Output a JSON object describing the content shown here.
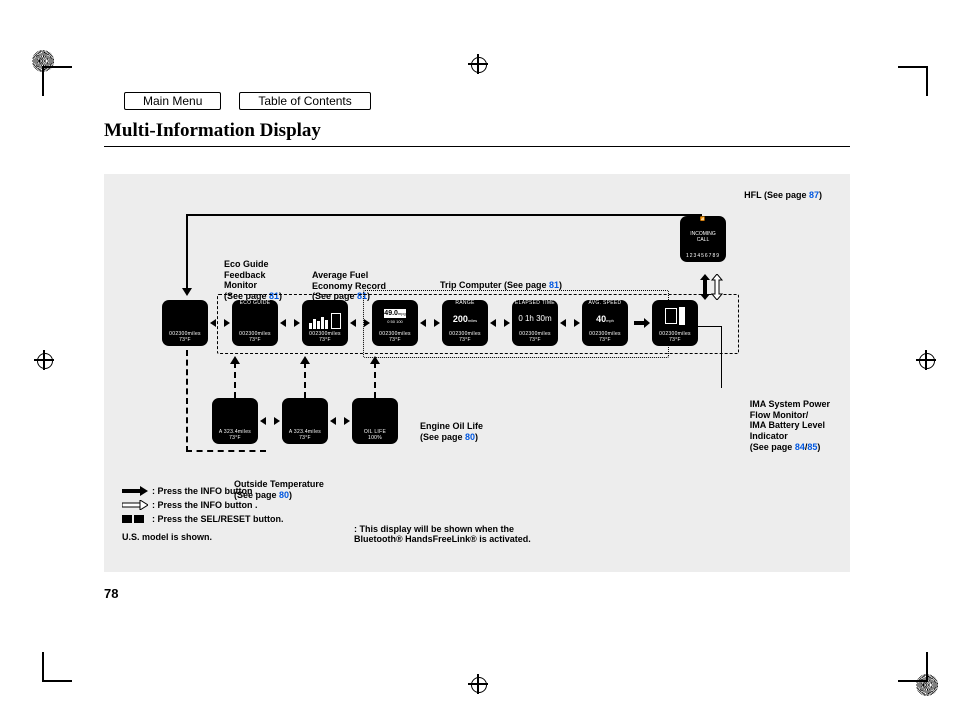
{
  "nav": {
    "main_menu": "Main Menu",
    "toc": "Table of Contents"
  },
  "title": "Multi-Information Display",
  "page_number": "78",
  "labels": {
    "hfl": "HFL   (See page ",
    "hfl_pg": "87",
    "hfl_end": ")",
    "eco": "Eco Guide\nFeedback\nMonitor\n(See page ",
    "eco_pg": "81",
    "eco_end": ")",
    "avg": "Average Fuel\nEconomy Record\n(See page ",
    "avg_pg": "81",
    "avg_end": ")",
    "trip": "Trip Computer (See page ",
    "trip_pg": "81",
    "trip_end": ")",
    "oil": "Engine Oil Life\n(See page ",
    "oil_pg": "80",
    "oil_end": ")",
    "out": "Outside Temperature\n(See page ",
    "out_pg": "80",
    "out_end": ")",
    "ima": "IMA System Power\nFlow Monitor/\nIMA Battery Level\nIndicator\n(See page ",
    "ima_pg1": "84",
    "ima_slash": "/",
    "ima_pg2": "85",
    "ima_end": ")"
  },
  "icons": {
    "odo": "002300miles",
    "temp": "73°F",
    "mpg": "49.0",
    "mpg_u": "mpg",
    "range": "RANGE",
    "range_v": "200",
    "range_u": "miles",
    "elapsed": "ELAPSED TIME",
    "elapsed_v": "0 1h  30m",
    "avg_speed": "AVG. SPEED",
    "avg_speed_v": "40",
    "avg_speed_u": "mph",
    "eco_head": "ECO GUIDE",
    "incoming": "INCOMING\nCALL",
    "incoming_num": "123456789",
    "trip_odo": "A  323.4miles",
    "oil_head": "OIL LIFE",
    "oil_v": "100%"
  },
  "legend": {
    "l1": ": Press the INFO button      .",
    "l2": ": Press the INFO button      .",
    "l3": ": Press the SEL/RESET button.",
    "us": "U.S. model is shown."
  },
  "footnote": ": This display will be shown when the\nBluetooth® HandsFreeLink® is activated."
}
